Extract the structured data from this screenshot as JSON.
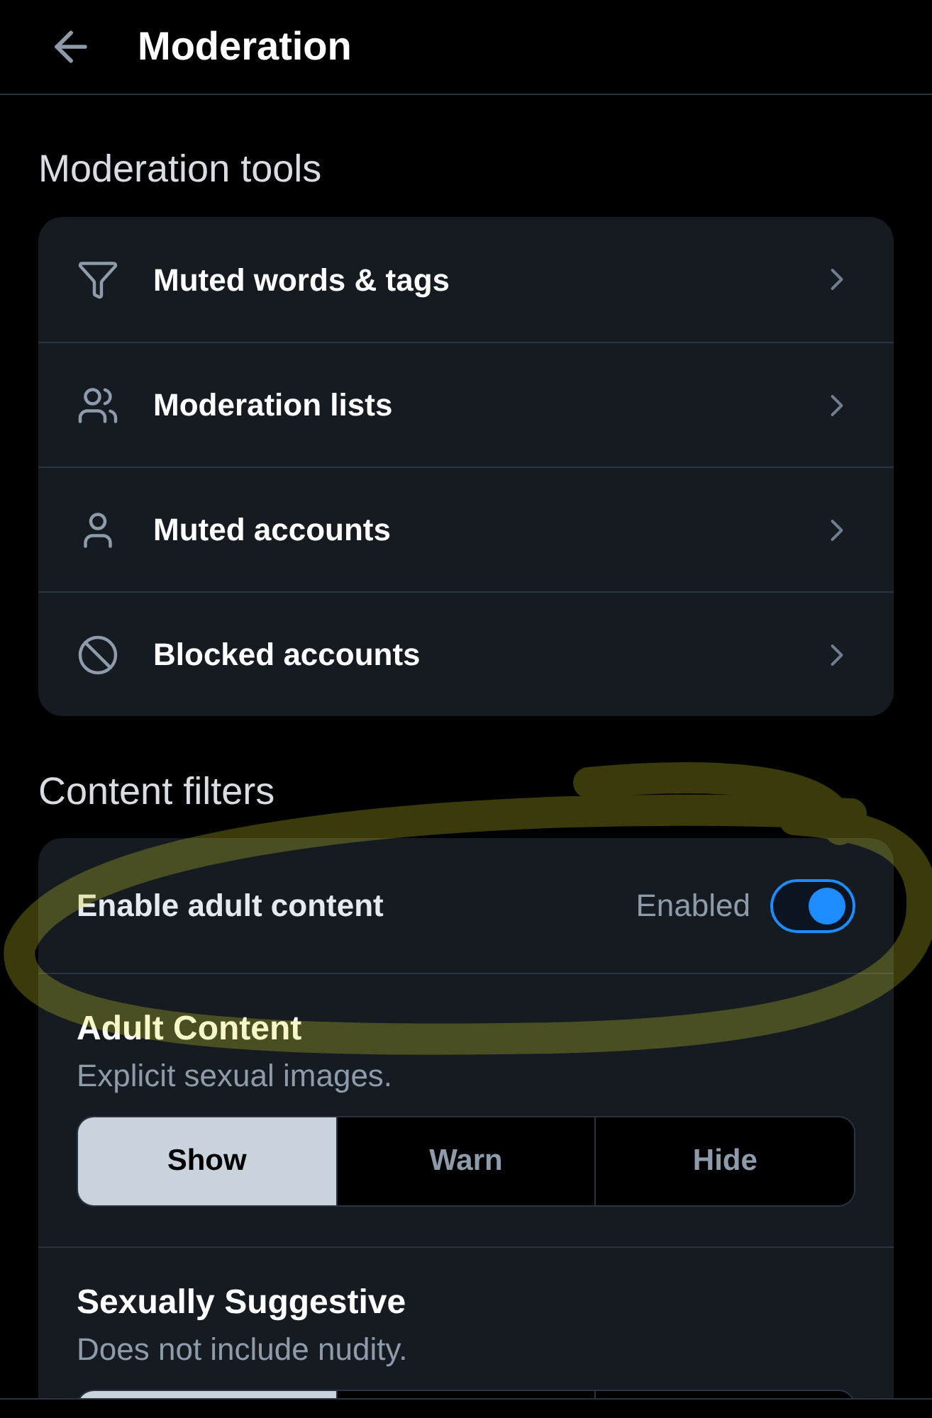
{
  "header": {
    "title": "Moderation"
  },
  "moderation_tools": {
    "heading": "Moderation tools",
    "items": [
      {
        "label": "Muted words & tags"
      },
      {
        "label": "Moderation lists"
      },
      {
        "label": "Muted accounts"
      },
      {
        "label": "Blocked accounts"
      }
    ]
  },
  "content_filters": {
    "heading": "Content filters",
    "adult_toggle": {
      "label": "Enable adult content",
      "status": "Enabled",
      "on": true
    },
    "filters": [
      {
        "title": "Adult Content",
        "description": "Explicit sexual images.",
        "options": [
          {
            "label": "Show",
            "selected": true
          },
          {
            "label": "Warn",
            "selected": false
          },
          {
            "label": "Hide",
            "selected": false
          }
        ]
      },
      {
        "title": "Sexually Suggestive",
        "description": "Does not include nudity.",
        "options": [
          {
            "selected": true
          },
          {
            "selected": false
          },
          {
            "selected": false
          }
        ]
      }
    ]
  }
}
